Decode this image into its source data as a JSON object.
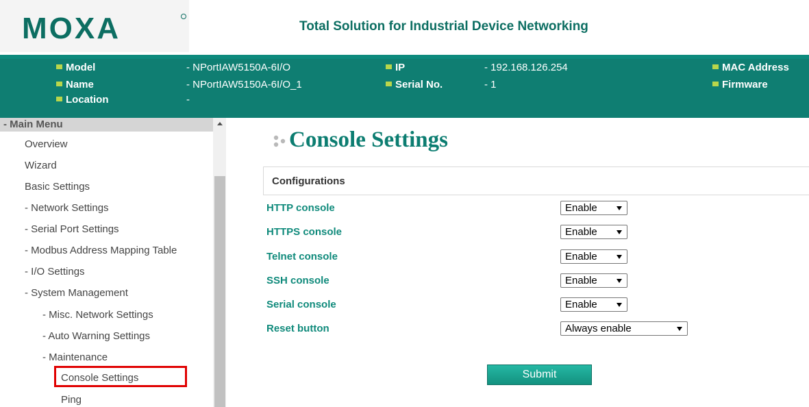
{
  "header": {
    "brand": "MOXA",
    "tagline": "Total Solution for Industrial Device Networking"
  },
  "device_info": {
    "model_label": "Model",
    "model_value": "- NPortIAW5150A-6I/O",
    "name_label": "Name",
    "name_value": "- NPortIAW5150A-6I/O_1",
    "location_label": "Location",
    "location_value": "-",
    "ip_label": "IP",
    "ip_value": "- 192.168.126.254",
    "serial_label": "Serial No.",
    "serial_value": "- 1",
    "mac_label": "MAC Address",
    "firmware_label": "Firmware"
  },
  "sidebar": {
    "heading": "- Main Menu",
    "items": [
      "Overview",
      "Wizard",
      "Basic Settings",
      "- Network Settings",
      "- Serial Port Settings",
      "- Modbus Address Mapping Table",
      "- I/O Settings",
      "- System Management",
      "- Misc. Network Settings",
      "- Auto Warning Settings",
      "- Maintenance",
      "Console Settings",
      "Ping"
    ],
    "selected": "Console Settings"
  },
  "main": {
    "title": "Console Settings",
    "section": "Configurations",
    "fields": [
      {
        "label": "HTTP console",
        "value": "Enable"
      },
      {
        "label": "HTTPS console",
        "value": "Enable"
      },
      {
        "label": "Telnet console",
        "value": "Enable"
      },
      {
        "label": "SSH console",
        "value": "Enable"
      },
      {
        "label": "Serial console",
        "value": "Enable"
      },
      {
        "label": "Reset button",
        "value": "Always enable"
      }
    ],
    "submit_label": "Submit"
  },
  "colors": {
    "brand_teal": "#0f7e72",
    "label_green": "#0f8a7b",
    "bullet_lime": "#b9d64b",
    "highlight_red": "#e00000"
  }
}
